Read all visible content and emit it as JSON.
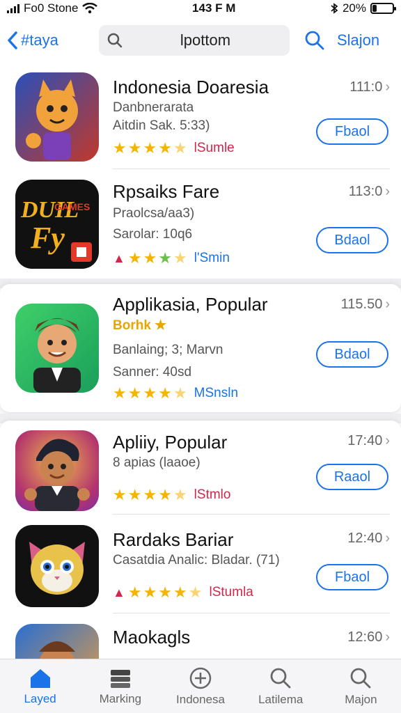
{
  "status": {
    "carrier": "Fo0 Stone",
    "time": "143 F M",
    "battery": "20%",
    "battery_level": 0.2
  },
  "nav": {
    "back_label": "#taya",
    "search_text": "lpottom",
    "right_label": "Slajon"
  },
  "apps": [
    {
      "title": "Indonesia Doaresia",
      "lines": [
        "Danbnerarata",
        "Aitdin Sak. 5:33)"
      ],
      "size": "111:0",
      "button": "Fbaol",
      "rating_label": "lSumle"
    },
    {
      "title": "Rpsaiks Fare",
      "lines": [
        "Praolcsa/aa3)",
        "Sarolar: 10q6"
      ],
      "size": "113:0",
      "button": "Bdaol",
      "rating_label": "l'Smin",
      "icon_text": [
        "DUIL",
        "Fy",
        "GAMES"
      ]
    },
    {
      "title": "Applikasia, Popular",
      "lines": [
        "Borhk",
        "Banlaing; 3; Marvn",
        "Sanner: 40sd"
      ],
      "size": "115.50",
      "button": "Bdaol",
      "rating_label": "MSnsln"
    },
    {
      "title": "Apliiy, Popular",
      "lines": [
        "8 apias (laaoe)"
      ],
      "size": "17:40",
      "button": "Raaol",
      "rating_label": "lStmlo"
    },
    {
      "title": "Rardaks Bariar",
      "lines": [
        "Casatdia Analic: Bladar. (71)"
      ],
      "size": "12:40",
      "button": "Fbaol",
      "rating_label": "lStumla"
    },
    {
      "title": "Maokagls",
      "lines": [],
      "size": "12:60"
    }
  ],
  "tabs": [
    {
      "label": "Layed",
      "icon": "home-icon"
    },
    {
      "label": "Marking",
      "icon": "stack-icon"
    },
    {
      "label": "Indonesa",
      "icon": "plus-circle-icon"
    },
    {
      "label": "Latilema",
      "icon": "search-icon"
    },
    {
      "label": "Majon",
      "icon": "search-icon"
    }
  ],
  "colors": {
    "accent": "#1a73e8",
    "star": "#f4b400",
    "rating_label": "#d0284b"
  }
}
